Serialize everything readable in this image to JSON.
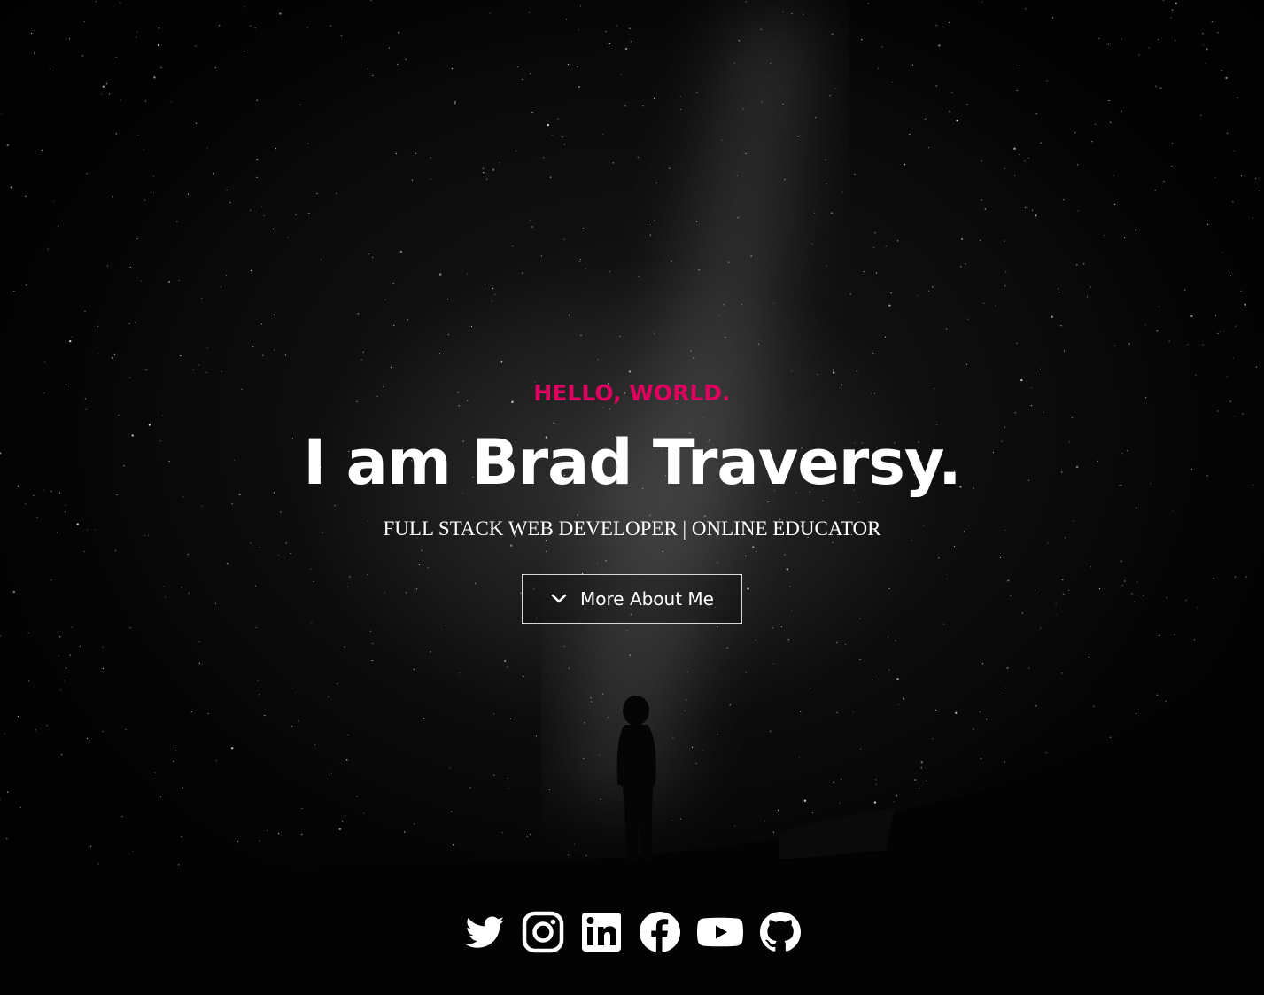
{
  "hero": {
    "greeting": "HELLO, WORLD.",
    "headline": "I am Brad Traversy.",
    "tagline": "FULL STACK WEB DEVELOPER | ONLINE EDUCATOR",
    "button_label": "More About Me",
    "button_icon": "chevron-down-icon"
  },
  "social": {
    "icons": [
      "twitter-icon",
      "instagram-icon",
      "linkedin-icon",
      "facebook-icon",
      "youtube-icon",
      "github-icon"
    ]
  },
  "colors": {
    "accent": "#e0005f",
    "text": "#ffffff",
    "background": "#000000"
  }
}
